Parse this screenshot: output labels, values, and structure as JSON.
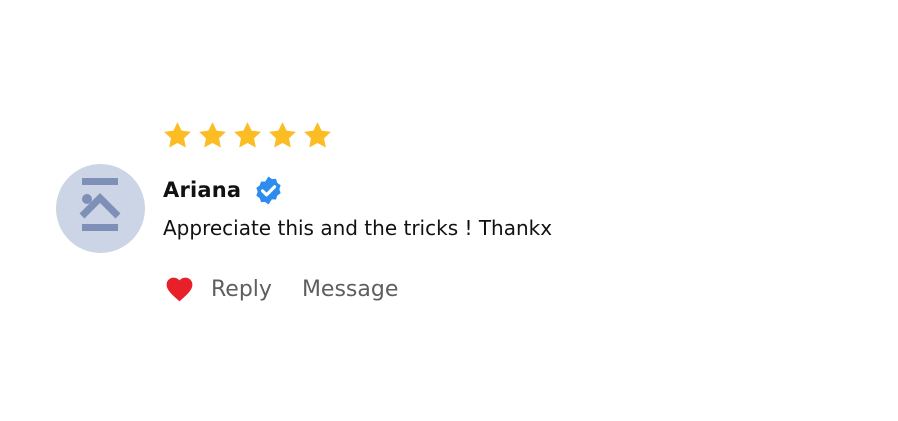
{
  "review": {
    "rating": 5,
    "rating_max": 5,
    "author": "Ariana",
    "verified": true,
    "comment": "Appreciate this and the tricks ! Thankx",
    "liked": true,
    "actions": {
      "reply_label": "Reply",
      "message_label": "Message"
    }
  },
  "icons": {
    "star": "star-filled-icon",
    "verified": "verified-badge-icon",
    "heart": "heart-filled-icon",
    "avatar": "default-avatar-icon"
  },
  "colors": {
    "star": "#FBBC24",
    "verified": "#2D8CF0",
    "heart": "#E8202A",
    "avatar_bg": "#CCD5E6",
    "avatar_fg": "#7F90B8",
    "text": "#111111",
    "action_text": "#5E5E5E",
    "background": "#FFFFFF"
  }
}
